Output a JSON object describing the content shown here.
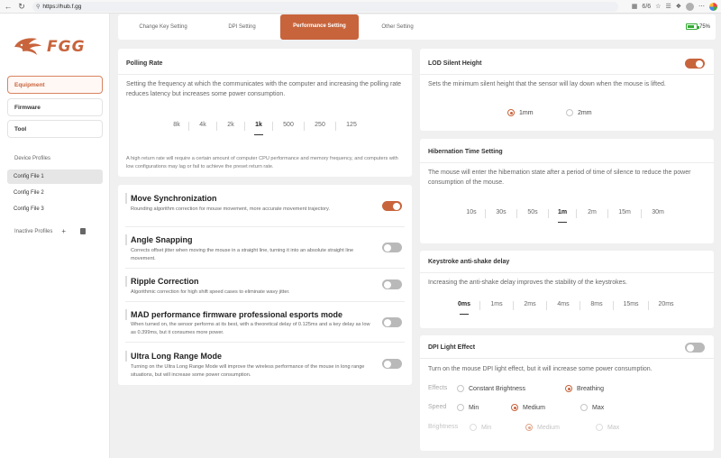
{
  "browser": {
    "url": "https://hub.f.gg",
    "zoom": "6/6"
  },
  "sidebar": {
    "brand": "FGG",
    "nav": [
      {
        "label": "Equipment",
        "active": true
      },
      {
        "label": "Firmware",
        "active": false
      },
      {
        "label": "Tool",
        "active": false
      }
    ],
    "profiles_label": "Device Profiles",
    "configs": [
      {
        "label": "Config File 1",
        "active": true
      },
      {
        "label": "Config File 2",
        "active": false
      },
      {
        "label": "Config File 3",
        "active": false
      }
    ],
    "inactive_label": "Inactive Profiles",
    "add_symbol": "+"
  },
  "tabs": [
    {
      "label": "Change Key Setting"
    },
    {
      "label": "DPI Setting"
    },
    {
      "label": "Performance Setting",
      "active": true
    },
    {
      "label": "Other Setting"
    }
  ],
  "battery": {
    "label": "75%",
    "level": 0.75
  },
  "polling": {
    "title": "Polling Rate",
    "description": "Setting the frequency at which the communicates with the computer and increasing the polling rate reduces latency but increases some power consumption.",
    "options": [
      "8k",
      "4k",
      "2k",
      "1k",
      "500",
      "250",
      "125"
    ],
    "selected": "1k",
    "note": "A high return rate will require a certain amount of computer CPU performance and memory frequency, and computers with low configurations may lag or fail to achieve the preset return rate."
  },
  "features": [
    {
      "title": "Move Synchronization",
      "desc": "Rounding algorithm correction for mouse movement, more accurate movement trajectory.",
      "on": true
    },
    {
      "title": "Angle Snapping",
      "desc": "Corrects offset jitter when moving the mouse in a straight line, turning it into an absolute straight line movement.",
      "on": false
    },
    {
      "title": "Ripple Correction",
      "desc": "Algorithmic correction for high shift speed cases to eliminate wavy jitter.",
      "on": false
    },
    {
      "title": "MAD performance firmware professional esports mode",
      "desc": "When turned on, the sensor performs at its best, with a theoretical delay of 0.125ms and a key delay as low as 0.399ms, but it consumes more power.",
      "on": false
    },
    {
      "title": "Ultra Long Range Mode",
      "desc": "Turning on the Ultra Long Range Mode will improve the wireless performance of the mouse in long range situations, but will increase some power consumption.",
      "on": false
    }
  ],
  "lod": {
    "title": "LOD Silent Height",
    "on": true,
    "description": "Sets the minimum silent height that the sensor will lay down when the mouse is lifted.",
    "options": [
      "1mm",
      "2mm"
    ],
    "selected": "1mm"
  },
  "hibernation": {
    "title": "Hibernation Time Setting",
    "description": "The mouse will enter the hibernation state after a period of time of silence to reduce the power consumption of the mouse.",
    "options": [
      "10s",
      "30s",
      "50s",
      "1m",
      "2m",
      "15m",
      "30m"
    ],
    "selected": "1m"
  },
  "keystroke": {
    "title": "Keystroke anti-shake delay",
    "description": "Increasing the anti-shake delay improves the stability of the keystrokes.",
    "options": [
      "0ms",
      "1ms",
      "2ms",
      "4ms",
      "8ms",
      "15ms",
      "20ms"
    ],
    "selected": "0ms"
  },
  "dpi_light": {
    "title": "DPI Light Effect",
    "on": false,
    "description": "Turn on the mouse DPI light effect, but it will increase some power consumption.",
    "effects_label": "Effects",
    "effects": [
      "Constant Brightness",
      "Breathing"
    ],
    "effects_selected": "Breathing",
    "speed_label": "Speed",
    "speeds": [
      "Min",
      "Medium",
      "Max"
    ],
    "speed_selected": "Medium",
    "brightness_label": "Brightness",
    "brightness": [
      "Min",
      "Medium",
      "Max"
    ],
    "brightness_selected": "Medium"
  },
  "colors": {
    "accent": "#c8643c",
    "toggle_off": "#b9b9b9",
    "background": "#f0f0f0"
  }
}
